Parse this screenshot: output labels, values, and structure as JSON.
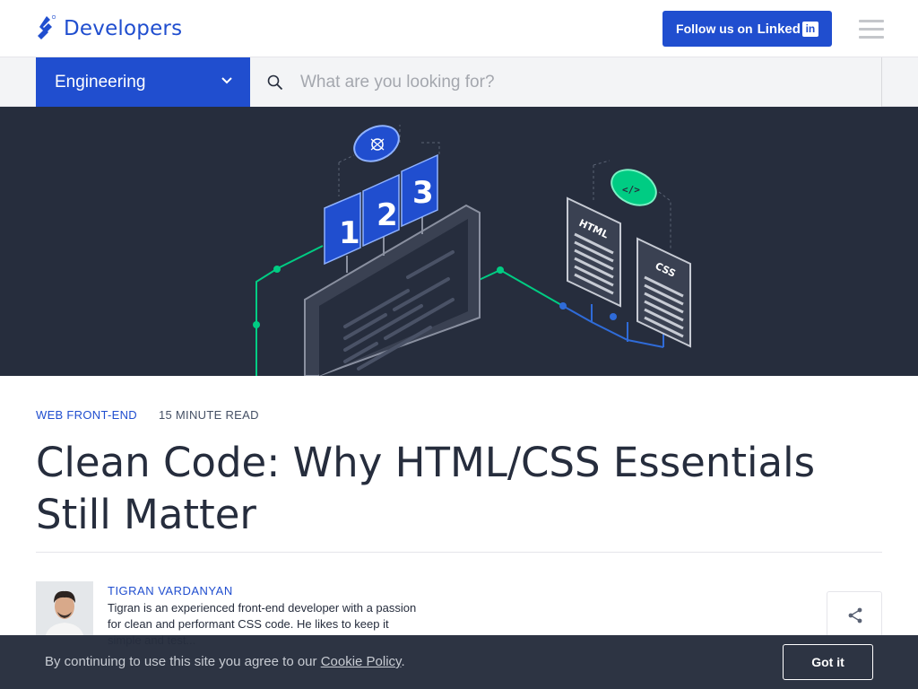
{
  "header": {
    "logo_text": "Developers",
    "follow_label": "Follow us on",
    "follow_brand": "Linked",
    "follow_brand_box": "in"
  },
  "subnav": {
    "category": "Engineering",
    "search_placeholder": "What are you looking for?"
  },
  "hero": {
    "badges": [
      "1",
      "2",
      "3"
    ],
    "doc_html": "HTML",
    "doc_css": "CSS",
    "code_tag": "</>"
  },
  "article": {
    "category": "WEB FRONT-END",
    "read_time": "15 MINUTE READ",
    "title": "Clean Code: Why HTML/CSS Essentials Still Matter"
  },
  "author": {
    "name": "TIGRAN VARDANYAN",
    "bio": "Tigran is an experienced front-end developer with a passion for clean and performant CSS code. He likes to keep it simple and test..."
  },
  "cookie": {
    "text": "By continuing to use this site you agree to our",
    "link": "Cookie Policy",
    "end": ".",
    "button": "Got it"
  },
  "colors": {
    "brand_blue": "#204ecf",
    "dark_navy": "#262d3d",
    "accent_green": "#00cc83"
  },
  "icons": [
    "toptal-logo-icon",
    "linkedin-icon",
    "hamburger-menu-icon",
    "chevron-down-icon",
    "search-icon",
    "bug-icon",
    "code-icon",
    "share-icon"
  ]
}
